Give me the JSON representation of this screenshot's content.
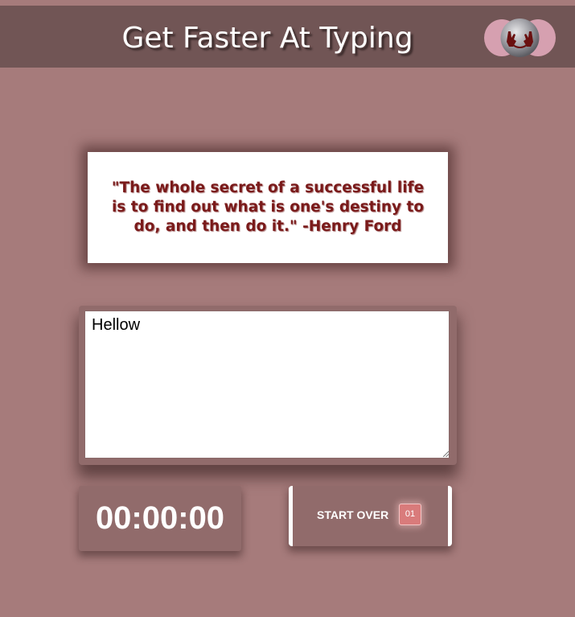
{
  "header": {
    "title": "Get Faster At Typing",
    "logo_icon": "hands-globe-logo-icon"
  },
  "quote": {
    "text": "\"The whole secret of a successful life is to find out what is one's destiny to do, and then do it.\" -Henry Ford"
  },
  "typing": {
    "value": "Hellow"
  },
  "timer": {
    "value": "00:00:00"
  },
  "reset": {
    "label": "START OVER",
    "badge": "01"
  },
  "colors": {
    "background": "#a67b7b",
    "header": "#715555",
    "panel": "#916b6b",
    "quote_text": "#7a1a1a",
    "badge": "#d97b7b"
  }
}
